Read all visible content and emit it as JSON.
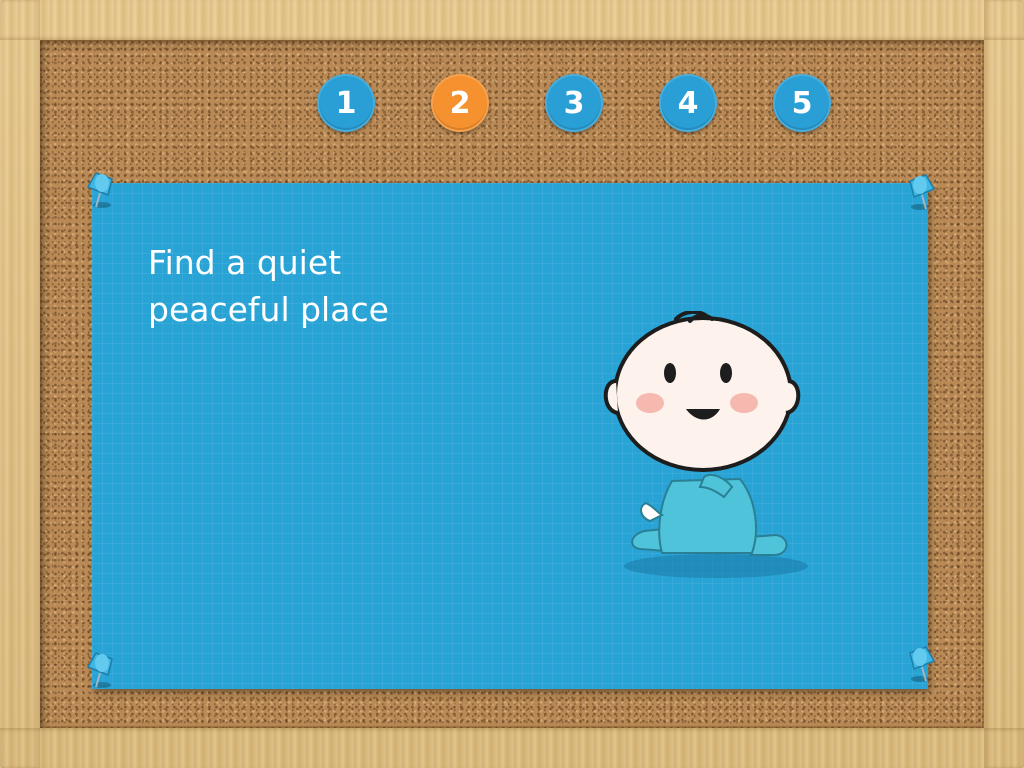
{
  "steps": [
    {
      "label": "1",
      "state": "default"
    },
    {
      "label": "2",
      "state": "active"
    },
    {
      "label": "3",
      "state": "default"
    },
    {
      "label": "4",
      "state": "default"
    },
    {
      "label": "5",
      "state": "default"
    }
  ],
  "card": {
    "lines": [
      "Find a quiet",
      "peaceful place"
    ]
  },
  "colors": {
    "step_default": "#2a9fd6",
    "step_active": "#f5922f",
    "card": "#27a3d6",
    "pin": "#3fb6e4"
  },
  "illustration": {
    "name": "baby-character",
    "pins": [
      "pushpin-icon",
      "pushpin-icon",
      "pushpin-icon",
      "pushpin-icon"
    ]
  }
}
